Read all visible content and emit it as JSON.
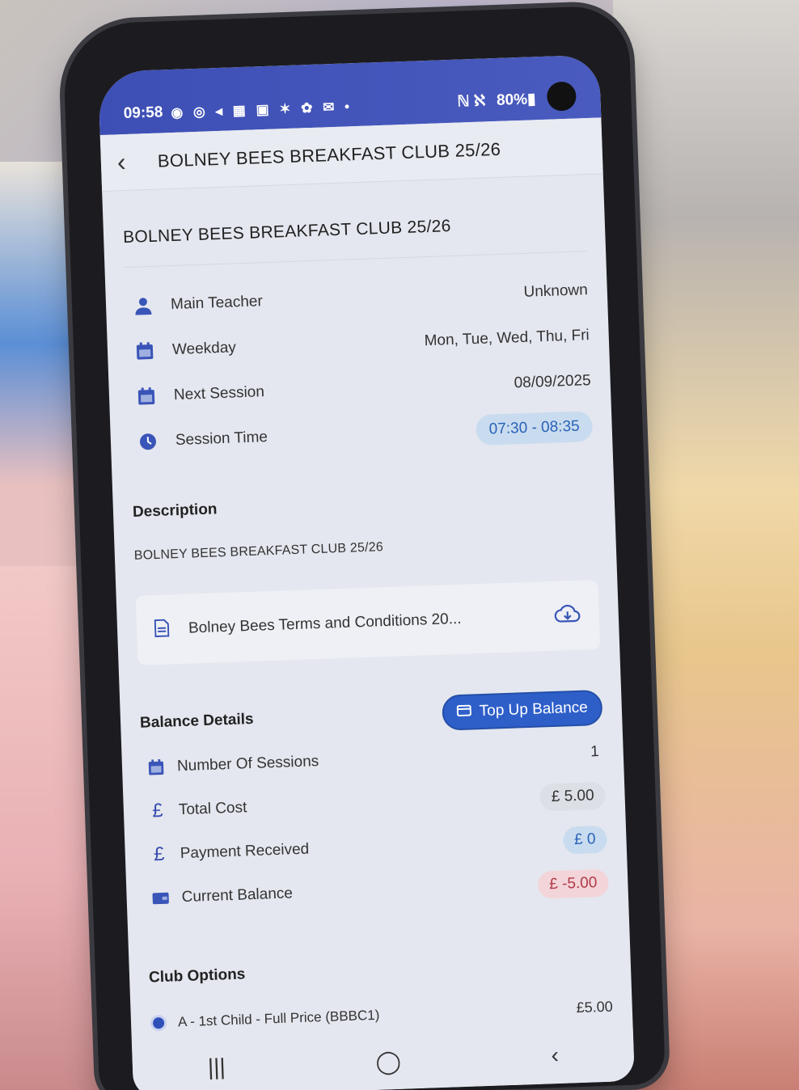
{
  "status_bar": {
    "time": "09:58",
    "icons": "◉ ◎ ◂ ▦ ▣ ✶ ✿ ✉ •",
    "signal": "ℕ ℵ",
    "battery": "80%▮"
  },
  "top_bar": {
    "back": "‹",
    "title": "BOLNEY BEES BREAKFAST CLUB 25/26"
  },
  "club": {
    "title": "BOLNEY BEES BREAKFAST CLUB 25/26",
    "details": [
      {
        "label": "Main Teacher",
        "value": "Unknown",
        "icon": "person-icon"
      },
      {
        "label": "Weekday",
        "value": "Mon, Tue, Wed, Thu, Fri",
        "icon": "calendar-icon"
      },
      {
        "label": "Next Session",
        "value": "08/09/2025",
        "icon": "calendar-icon"
      },
      {
        "label": "Session Time",
        "value": "07:30 - 08:35",
        "icon": "clock-icon"
      }
    ]
  },
  "description": {
    "title": "Description",
    "text": "BOLNEY BEES BREAKFAST CLUB 25/26",
    "document": "Bolney Bees Terms and Conditions 20..."
  },
  "balance": {
    "title": "Balance Details",
    "top_up_label": "Top Up Balance",
    "rows": [
      {
        "label": "Number Of Sessions",
        "value": "1"
      },
      {
        "label": "Total Cost",
        "value": "£  5.00"
      },
      {
        "label": "Payment Received",
        "value": "£  0"
      },
      {
        "label": "Current Balance",
        "value": "£  -5.00"
      }
    ]
  },
  "club_options": {
    "title": "Club Options",
    "options": [
      {
        "label": "A - 1st Child - Full Price (BBBC1)",
        "price": "£5.00"
      }
    ]
  },
  "nav": {
    "recent": "|||",
    "home": "◯",
    "back": "‹"
  },
  "colors": {
    "status_bar": "#3d4fb5",
    "accent": "#2e5fc9",
    "negative": "#b03a48"
  }
}
